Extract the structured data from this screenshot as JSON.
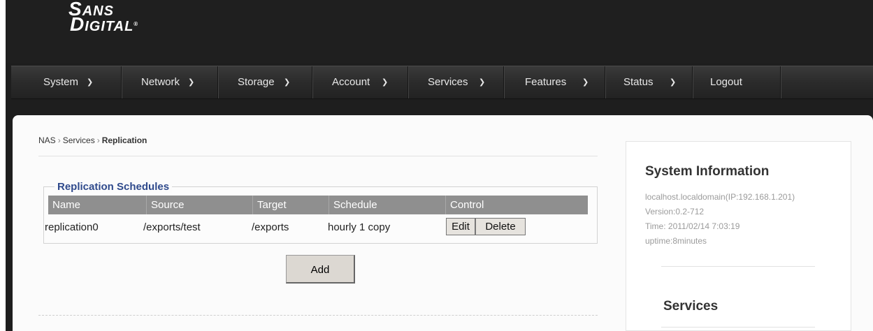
{
  "logo": {
    "line1": "SANS",
    "line2": "DIGITAL",
    "mark": "®"
  },
  "nav": {
    "items": [
      {
        "label": "System",
        "has_dropdown": true
      },
      {
        "label": "Network",
        "has_dropdown": true
      },
      {
        "label": "Storage",
        "has_dropdown": true
      },
      {
        "label": "Account",
        "has_dropdown": true
      },
      {
        "label": "Services",
        "has_dropdown": true
      },
      {
        "label": "Features",
        "has_dropdown": true
      },
      {
        "label": "Status",
        "has_dropdown": true
      },
      {
        "label": "Logout",
        "has_dropdown": false
      }
    ],
    "chevron_icon": "chevron-down-icon"
  },
  "breadcrumb": {
    "root": "NAS",
    "section": "Services",
    "current": "Replication",
    "separator": "›"
  },
  "schedules": {
    "legend": "Replication Schedules",
    "columns": [
      "Name",
      "Source",
      "Target",
      "Schedule",
      "Control"
    ],
    "rows": [
      {
        "name": "replication0",
        "source": "/exports/test",
        "target": "/exports",
        "schedule": "hourly 1 copy",
        "edit_label": "Edit",
        "delete_label": "Delete"
      }
    ],
    "add_label": "Add"
  },
  "sidebar": {
    "title": "System Information",
    "host": "localhost.localdomain(IP:192.168.1.201)",
    "version": "Version:0.2-712",
    "time": "Time: 2011/02/14 7:03:19",
    "uptime": "uptime:8minutes",
    "services_title": "Services"
  },
  "colors": {
    "header_bg": "#1f1f1f",
    "content_bg": "#fbfbfb",
    "legend_text": "#2f4a8c",
    "table_header_bg": "#8f8f8f"
  }
}
